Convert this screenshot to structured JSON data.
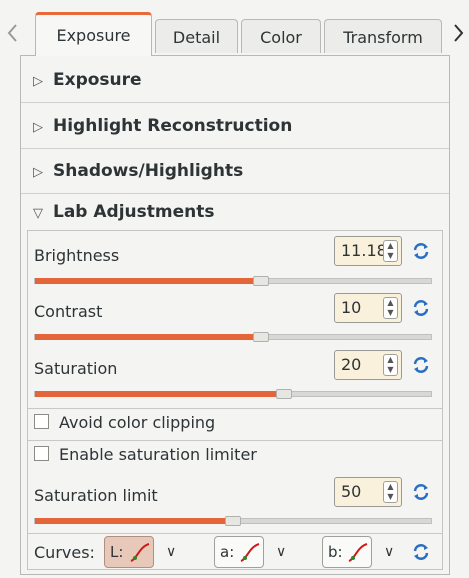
{
  "tabs": [
    "Exposure",
    "Detail",
    "Color",
    "Transform"
  ],
  "active_tab": "Exposure",
  "sections": {
    "exposure": "Exposure",
    "highlight": "Highlight Reconstruction",
    "shadows": "Shadows/Highlights",
    "lab": "Lab Adjustments"
  },
  "lab": {
    "brightness": {
      "label": "Brightness",
      "value": "11.18",
      "level": 0.57
    },
    "contrast": {
      "label": "Contrast",
      "value": "10",
      "level": 0.57
    },
    "saturation": {
      "label": "Saturation",
      "value": "20",
      "level": 0.63
    },
    "avoid_clipping": {
      "label": "Avoid color clipping",
      "checked": false
    },
    "enable_limiter": {
      "label": "Enable saturation limiter",
      "checked": false
    },
    "saturation_limit": {
      "label": "Saturation limit",
      "value": "50",
      "level": 0.5
    },
    "curves": {
      "label": "Curves:",
      "l": "L:",
      "a": "a:",
      "b": "b:"
    }
  },
  "colors": {
    "accent": "#e4653a",
    "spin_bg": "#f9f1db",
    "reset_icon": "#2a6fc4"
  }
}
